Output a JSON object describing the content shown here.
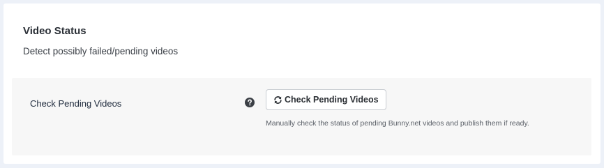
{
  "section": {
    "title": "Video Status",
    "description": "Detect possibly failed/pending videos"
  },
  "setting": {
    "label": "Check Pending Videos",
    "help_icon": "question-circle-icon",
    "button": {
      "icon": "refresh-icon",
      "label": "Check Pending Videos"
    },
    "help_text": "Manually check the status of pending Bunny.net videos and publish them if ready."
  },
  "colors": {
    "page_background": "#edf1f8",
    "card_background": "#ffffff",
    "panel_background": "#f7f7f7",
    "button_border": "#c8ccd1"
  }
}
